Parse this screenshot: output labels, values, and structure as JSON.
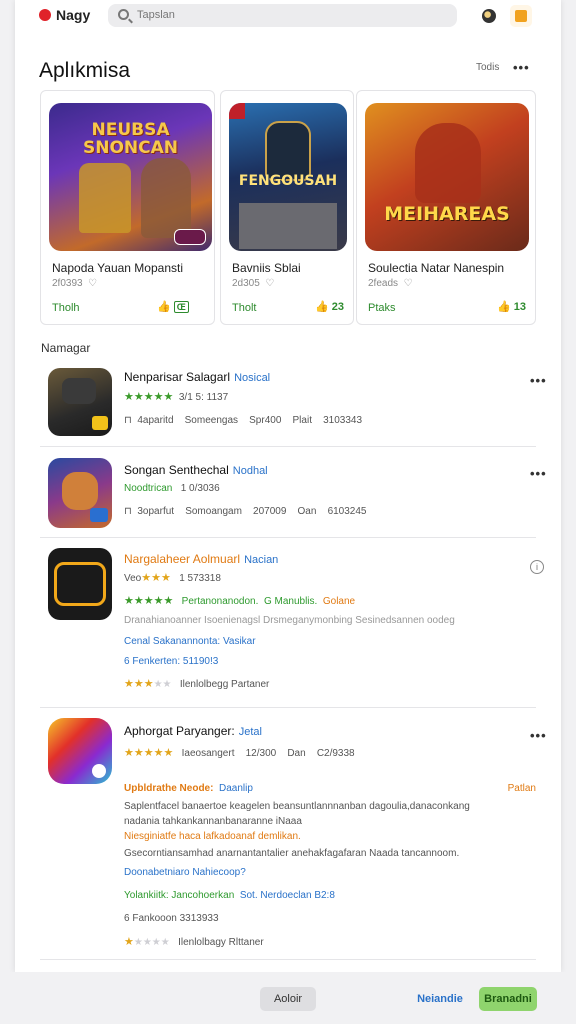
{
  "header": {
    "logo": "Nagy",
    "search_placeholder": "Tapslan"
  },
  "featured_section": {
    "title": "Aplıkmisa",
    "more": "Todis",
    "cards": [
      {
        "art_title": "NEUBSA SNONCAN",
        "title": "Napoda Yauan Mopansti",
        "meta": "2f0393",
        "label": "Tholh",
        "stat": "Œ"
      },
      {
        "art_title": "FENGOUSAH",
        "title": "Bavniis Sblai",
        "meta": "2d305",
        "label": "Tholt",
        "stat": "23"
      },
      {
        "art_title": "MEIHAREAS",
        "title": "Soulectia Natar Nanespin",
        "meta": "2feads",
        "label": "Ptaks",
        "stat": "13"
      }
    ]
  },
  "list_section": {
    "label": "Namagar",
    "items": [
      {
        "title": "Nenparisar Salagarl",
        "link": "Nosical",
        "line1": "3/1 5: 1137",
        "line2": [
          "4aparitd",
          "Someengas",
          "Spr400",
          "Plait",
          "3103343"
        ]
      },
      {
        "title": "Songan Senthechal",
        "link": "Nodhal",
        "line1_label": "Noodtrican",
        "line1": "1 0/3036",
        "line2": [
          "3oparfut",
          "Somoangam",
          "207009",
          "Oan",
          "6103245"
        ]
      },
      {
        "title": "Nargalaheer Aolmuarl",
        "link": "Nacian",
        "line1_label": "Veo",
        "line1": "1 573318",
        "line2_label": "Pertanonanodon.",
        "line2_green": "G Manublis.",
        "line2_orange": "Golane",
        "line3": "Dranahianoanner Isoenienagsl Drsmeganymonbing Sesinedsannen oodeg",
        "line4": "Cenal Sakanannonta: Vasikar",
        "line5": "6 Fenkerten: 51190!3",
        "line6": "Ilenlolbegg Partaner"
      },
      {
        "title": "Aphorgat Paryanger:",
        "link": "Jetal",
        "line1": [
          "Iaeosangert",
          "12/300",
          "Dan",
          "C2/9338"
        ],
        "subhead": "Upbldrathe Neode:",
        "subhead_link": "Daanlip",
        "subhead_right": "Patlan",
        "desc1": "Saplentfacel banaertoe keagelen beansuntlannnanban dagoulia,danaconkang",
        "desc2": "nadania tahkankannanbanaranne iNaaa",
        "desc3": "Niesginiatfe haca lafkadoanaf demlikan.",
        "desc4": "Gsecorntiansamhad anarnantantalier anehakfagafaran Naada tancannoom.",
        "desc5": "Doonabetniaro Nahiecoop?",
        "feature": "Yolankiitk: Jancohoerkan",
        "feature_link": "Sot. Nerdoeclan B2:8",
        "stat": "6 Fankooon 3313933",
        "footer": "Ilenlolbagy Rlttaner"
      }
    ]
  },
  "footer": {
    "btn_grey": "Aoloir",
    "btn_link": "Neiandie",
    "btn_green": "Branadni"
  }
}
